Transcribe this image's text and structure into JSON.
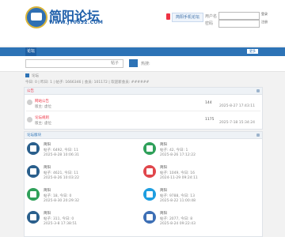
{
  "header": {
    "logo_title": "简阳论坛",
    "logo_url": "WWW.JY0832.COM",
    "mobile_link": "简阳手机论坛",
    "login_label": "用户名",
    "password_label": "密码",
    "login_button": "登录",
    "register_button": "注册"
  },
  "nav": {
    "items": [
      "论坛",
      "",
      "",
      "",
      "",
      "",
      "",
      ""
    ],
    "more": "更多"
  },
  "search": {
    "scope": "帖子",
    "hot_label": "热搜:"
  },
  "breadcrumb": "论坛",
  "stats": "今日: 0 | 昨日: 1 | 帖子: 1666346 | 会员: 101172 | 欢迎新会员: ######",
  "notice_panel": {
    "title": "公告",
    "rows": [
      {
        "title": "网站公告",
        "sub": "版主: 虚位",
        "count": "144",
        "last": "2025-8-27 17:43:11"
      },
      {
        "title": "论坛规则",
        "sub": "版主: 虚位",
        "count": "1175",
        "last": "2025-7-18 15:34:24"
      }
    ]
  },
  "forum_panel": {
    "title": "论坛版块",
    "forums": [
      {
        "name": "简阳",
        "stats": "帖子: 6492, 今日: 11",
        "last": "2025-8-28 10:06:31",
        "color": "#2a5f8c"
      },
      {
        "name": "简阳",
        "stats": "帖子: 42, 今日: 1",
        "last": "2025-8-26 17:12:22",
        "color": "#2fa05a"
      },
      {
        "name": "简阳",
        "stats": "帖子: 4621, 今日: 11",
        "last": "2025-8-26 10:03:22",
        "color": "#2a5f8c"
      },
      {
        "name": "简阳",
        "stats": "帖子: 1049, 今日: 16",
        "last": "2024-11-29 09:24:11",
        "color": "#e0474c"
      },
      {
        "name": "简阳",
        "stats": "帖子: 18, 今日: 0",
        "last": "2025-8-30 20:29:32",
        "color": "#2fa05a"
      },
      {
        "name": "简阳",
        "stats": "帖子: 9788, 今日: 13",
        "last": "2025-8-22 11:00:48",
        "color": "#1e9ee0"
      },
      {
        "name": "简阳",
        "stats": "帖子: 311, 今日: 0",
        "last": "2025-3-8 17:38:51",
        "color": "#2a5f8c"
      },
      {
        "name": "简阳",
        "stats": "帖子: 2077, 今日: 8",
        "last": "2025-8-24 09:22:43",
        "color": "#3d6fb5"
      }
    ]
  }
}
